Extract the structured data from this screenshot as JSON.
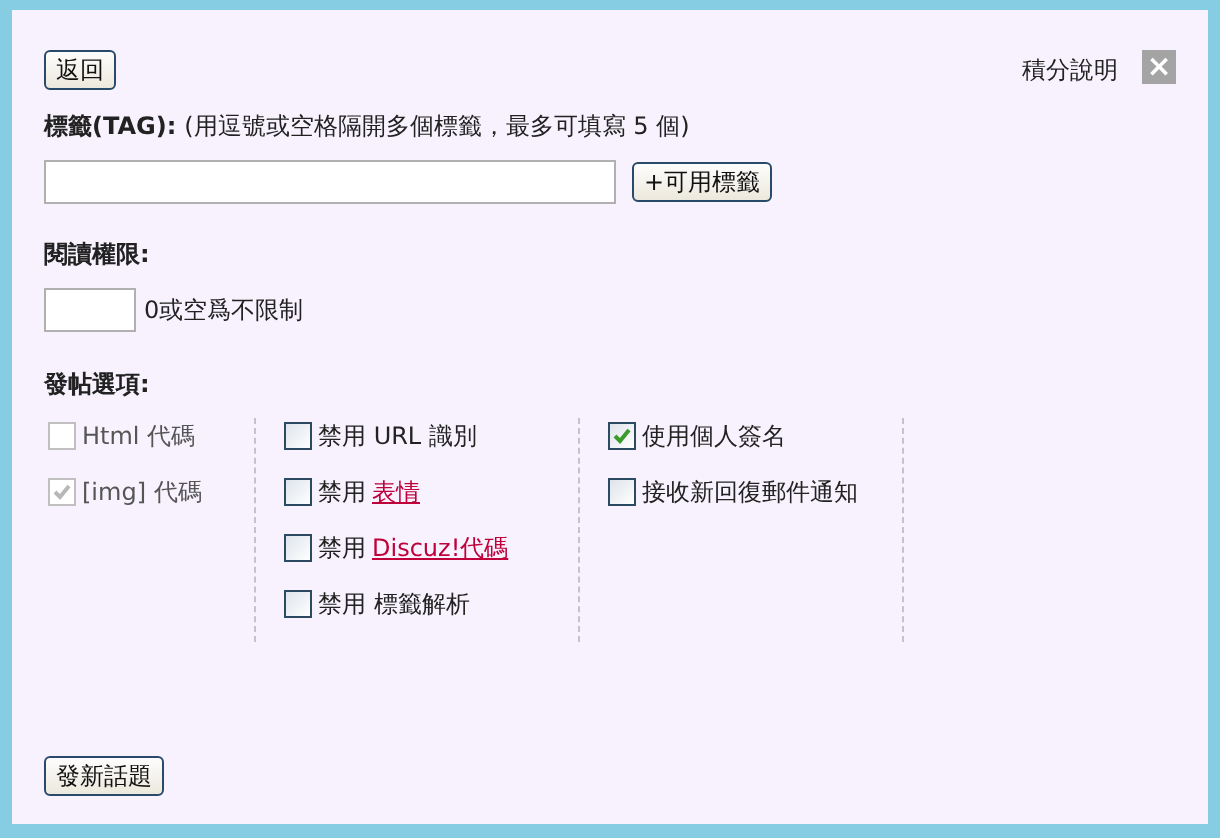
{
  "back_button": "返回",
  "credits_link": "積分說明",
  "close_button": "×",
  "tags": {
    "label": "標籤(TAG):",
    "hint": "(用逗號或空格隔開多個標籤，最多可填寫 5 個)",
    "value_button": "+可用標籤"
  },
  "read_permission": {
    "label": "閱讀權限:",
    "hint": "0或空爲不限制"
  },
  "post_options": {
    "label": "發帖選項:",
    "columns": [
      [
        {
          "text": "Html 代碼",
          "checked": false,
          "disabled": true
        },
        {
          "text": "[img] 代碼",
          "checked": true,
          "disabled": true
        }
      ],
      [
        {
          "text": "禁用 URL 識別",
          "checked": false,
          "disabled": false
        },
        {
          "text": "禁用",
          "link": "表情",
          "checked": false,
          "disabled": false
        },
        {
          "text": "禁用",
          "link": "Discuz!代碼",
          "checked": false,
          "disabled": false
        },
        {
          "text": "禁用 標籤解析",
          "checked": false,
          "disabled": false
        }
      ],
      [
        {
          "text": "使用個人簽名",
          "checked": true,
          "disabled": false
        },
        {
          "text": "接收新回復郵件通知",
          "checked": false,
          "disabled": false
        }
      ]
    ]
  },
  "submit_button": "發新話題"
}
